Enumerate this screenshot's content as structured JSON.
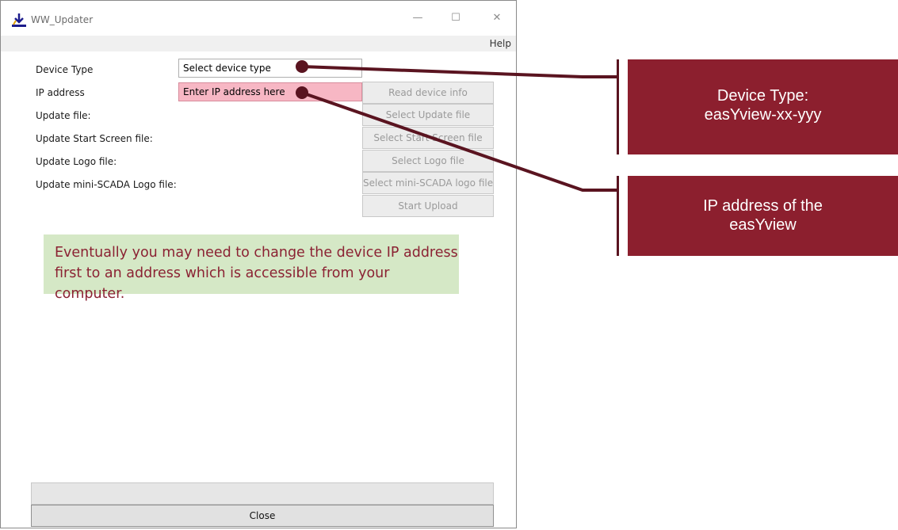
{
  "window": {
    "title": "WW_Updater",
    "app_icon": "download-arrow-icon",
    "controls": {
      "minimize": "—",
      "maximize": "☐",
      "close": "✕"
    }
  },
  "menu": {
    "help": "Help"
  },
  "form": {
    "device_type_label": "Device Type",
    "device_type_value": "Select device type",
    "ip_label": "IP address",
    "ip_value": "Enter IP address here",
    "update_file_label": "Update file:",
    "start_screen_label": "Update Start Screen file:",
    "logo_label": "Update Logo file:",
    "mini_scada_label": "Update mini-SCADA Logo file:"
  },
  "buttons": {
    "read_device_info": "Read device info",
    "select_update_file": "Select Update file",
    "select_start_screen": "Select Start Screen file",
    "select_logo": "Select Logo file",
    "select_mini_scada": "Select mini-SCADA logo file",
    "start_upload": "Start Upload",
    "close": "Close"
  },
  "note": {
    "line1": "Eventually you may need to change the device IP address",
    "line2": "first to an address which is accessible from your computer."
  },
  "callouts": {
    "device_type_line1": "Device Type:",
    "device_type_line2": "easYview-xx-yyy",
    "ip_line1": "IP address of the",
    "ip_line2": "easYview"
  },
  "colors": {
    "callout": "#8c1f2e",
    "ip_field": "#f7b7c4",
    "note_bg": "#d5e8c6",
    "note_text": "#8b2233"
  }
}
